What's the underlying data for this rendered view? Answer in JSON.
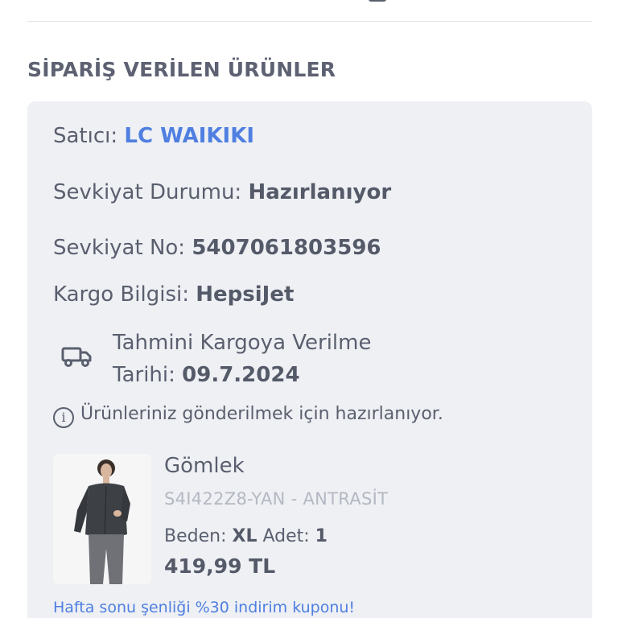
{
  "header": {
    "section_title": "SİPARİŞ VERİLEN ÜRÜNLER"
  },
  "order": {
    "seller_label": "Satıcı:",
    "seller_value": "LC WAIKIKI",
    "status_label": "Sevkiyat Durumu:",
    "status_value": "Hazırlanıyor",
    "shipment_no_label": "Sevkiyat No:",
    "shipment_no_value": "5407061803596",
    "cargo_label": "Kargo Bilgisi:",
    "cargo_value": "HepsiJet",
    "eta_label_line1": "Tahmini Kargoya Verilme",
    "eta_label_line2": "Tarihi:",
    "eta_value": "09.7.2024",
    "info_text": "Ürünleriniz gönderilmek için hazırlanıyor."
  },
  "product": {
    "name": "Gömlek",
    "sku": "S4I422Z8-YAN - ANTRASİT",
    "size_label": "Beden:",
    "size_value": "XL",
    "qty_label": "Adet:",
    "qty_value": "1",
    "price": "419,99 TL"
  },
  "promo": {
    "text": "Hafta sonu şenliği %30 indirim kuponu!"
  },
  "colors": {
    "accent_blue": "#4f7fe0",
    "card_bg": "#eef0f4",
    "text": "#5a5f6e",
    "muted": "#b4b8c2"
  },
  "icons": {
    "truck": "truck-icon",
    "info": "info-icon"
  }
}
